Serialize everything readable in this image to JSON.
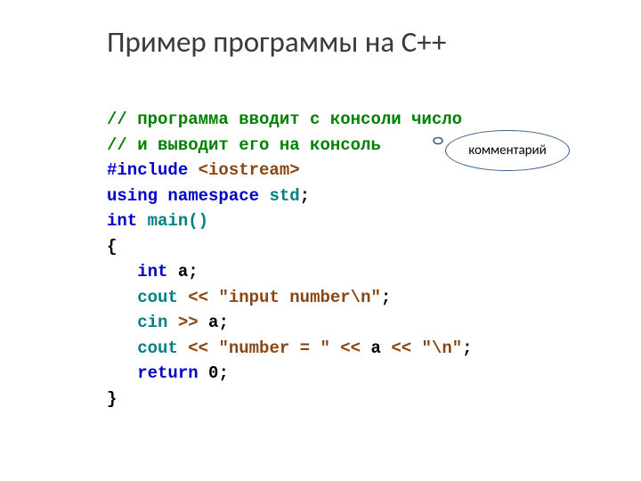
{
  "title": "Пример программы на С++",
  "code": {
    "comment1": "// программа вводит с консоли число",
    "comment2": "// и выводит его на консоль",
    "include_kw": "#include",
    "include_hdr": " <iostream>",
    "using_kw": "using",
    "namespace_kw": " namespace",
    "ns_name": " std",
    "semi": ";",
    "int_kw": "int",
    "main_name": " main()",
    "brace_open": "{",
    "indent": "   ",
    "var_a": " a",
    "cout1": "cout ",
    "op_ll": "<<",
    "str_input": " \"input number\\n\"",
    "cin": "cin ",
    "op_rr": ">>",
    "a_ref": " a",
    "cout2": "cout ",
    "str_number": " \"number = \" ",
    "a_out": " a ",
    "str_nl": " \"\\n\"",
    "return_kw": "return",
    "zero": " 0",
    "brace_close": "}"
  },
  "callout": {
    "label": "комментарий"
  }
}
